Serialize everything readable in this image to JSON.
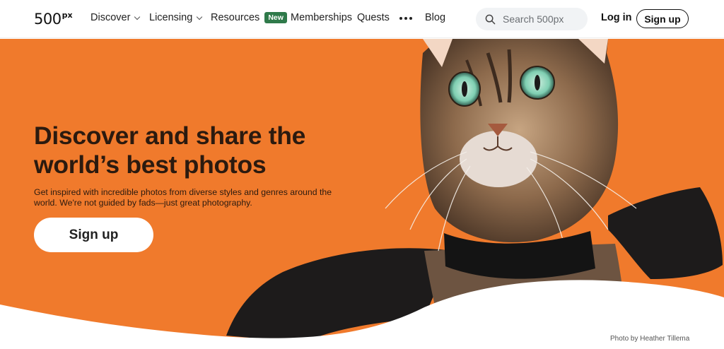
{
  "brand": {
    "logo_main": "500",
    "logo_sup": "px"
  },
  "nav": {
    "discover": "Discover",
    "licensing": "Licensing",
    "resources": "Resources",
    "resources_badge": "New",
    "memberships": "Memberships",
    "quests": "Quests",
    "blog": "Blog"
  },
  "search": {
    "placeholder": "Search 500px"
  },
  "auth": {
    "login": "Log in",
    "signup": "Sign up"
  },
  "hero": {
    "headline": "Discover and share the world’s best photos",
    "subtext": "Get inspired with incredible photos from diverse styles and genres around the world. We're not guided by fads—just great photography.",
    "cta": "Sign up",
    "credit": "Photo by Heather Tillema"
  },
  "colors": {
    "hero_bg": "#f07a2c",
    "badge": "#2f7a4a",
    "text_dark": "#2b1a0f"
  }
}
